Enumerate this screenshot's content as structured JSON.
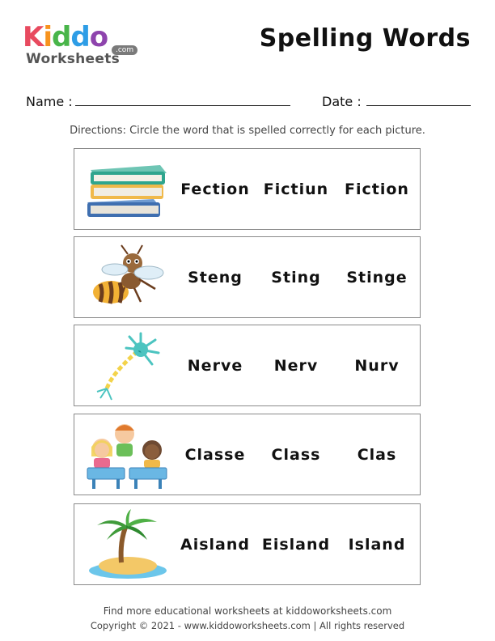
{
  "brand": {
    "letters": [
      {
        "ch": "K",
        "color": "#e84a5f"
      },
      {
        "ch": "i",
        "color": "#f7931e"
      },
      {
        "ch": "d",
        "color": "#49b54a"
      },
      {
        "ch": "d",
        "color": "#2e9de6"
      },
      {
        "ch": "o",
        "color": "#8e44ad"
      }
    ],
    "subtitle": "Worksheets",
    "domain_badge": ".com"
  },
  "header": {
    "title": "Spelling Words"
  },
  "fields": {
    "name_label": "Name :",
    "date_label": "Date :"
  },
  "directions": "Directions: Circle the word that is spelled correctly for each picture.",
  "rows": [
    {
      "picture": "books-icon",
      "options": [
        "Fection",
        "Fictiun",
        "Fiction"
      ]
    },
    {
      "picture": "bee-icon",
      "options": [
        "Steng",
        "Sting",
        "Stinge"
      ]
    },
    {
      "picture": "neuron-icon",
      "options": [
        "Nerve",
        "Nerv",
        "Nurv"
      ]
    },
    {
      "picture": "classroom-kids-icon",
      "options": [
        "Classe",
        "Class",
        "Clas"
      ]
    },
    {
      "picture": "palm-island-icon",
      "options": [
        "Aisland",
        "Eisland",
        "Island"
      ]
    }
  ],
  "footer": {
    "line1": "Find more educational worksheets at kiddoworksheets.com",
    "line2": "Copyright © 2021 - www.kiddoworksheets.com  |  All rights reserved"
  }
}
